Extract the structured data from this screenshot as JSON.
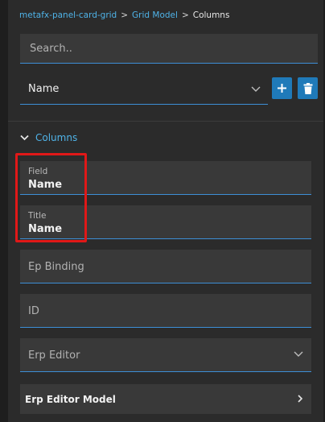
{
  "breadcrumb": {
    "items": [
      "metafx-panel-card-grid",
      "Grid Model"
    ],
    "separator": ">",
    "current": "Columns"
  },
  "search": {
    "placeholder": "Search..",
    "value": ""
  },
  "column_select": {
    "value": "Name"
  },
  "buttons": {
    "add_icon": "plus-icon",
    "delete_icon": "trash-icon"
  },
  "section": {
    "label": "Columns"
  },
  "fields": {
    "field": {
      "label": "Field",
      "value": "Name"
    },
    "title": {
      "label": "Title",
      "value": "Name"
    },
    "ep_binding": {
      "placeholder": "Ep Binding"
    },
    "id": {
      "placeholder": "ID"
    },
    "erp_editor": {
      "placeholder": "Erp Editor"
    }
  },
  "erp_editor_model": {
    "label": "Erp Editor Model"
  },
  "colors": {
    "accent": "#4fb3e8",
    "button": "#1f7ab9",
    "highlight": "#e01818",
    "panel": "#2b2b2b",
    "input": "#393939"
  }
}
